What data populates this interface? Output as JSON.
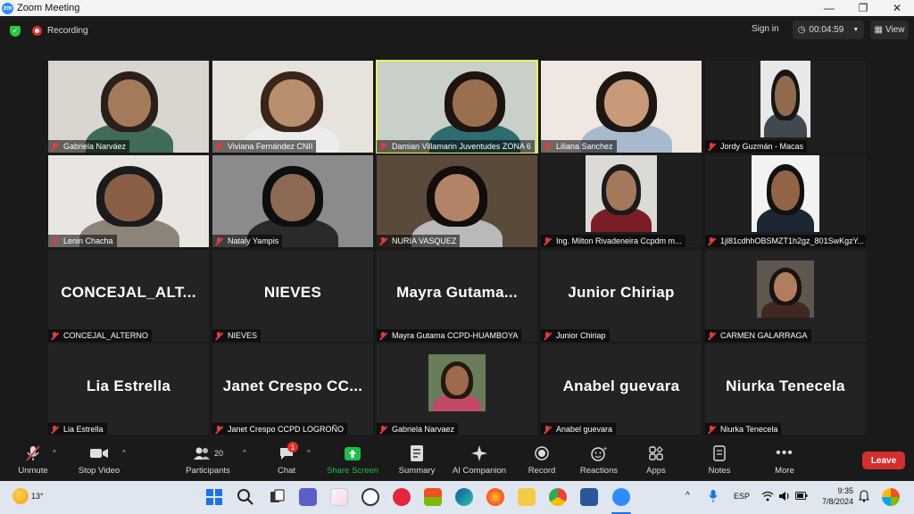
{
  "window": {
    "title": "Zoom Meeting",
    "app_badge": "zm"
  },
  "meeting_bar": {
    "recording_label": "Recording",
    "signin_label": "Sign in",
    "timer": "00:04:59",
    "view_label": "View"
  },
  "participants_tiles": [
    {
      "name": "Gabriela Narváez",
      "big": ""
    },
    {
      "name": "Viviana Fernández CNII",
      "big": ""
    },
    {
      "name": "Damian Villamarin Juventudes ZONA 6",
      "big": "",
      "active": true
    },
    {
      "name": "Liliana Sanchez",
      "big": ""
    },
    {
      "name": "Jordy Guzmán - Macas",
      "big": ""
    },
    {
      "name": "Lenin Chacha",
      "big": ""
    },
    {
      "name": "Nataly Yampis",
      "big": ""
    },
    {
      "name": "NURIA VASQUEZ",
      "big": ""
    },
    {
      "name": "Ing. Milton Rivadeneira Ccpdm m...",
      "big": ""
    },
    {
      "name": "1jl81cdhhOBSMZT1h2gz_801SwKgzY...",
      "big": ""
    },
    {
      "name": "CONCEJAL_ALTERNO",
      "big": "CONCEJAL_ALT..."
    },
    {
      "name": "NIEVES",
      "big": "NIEVES"
    },
    {
      "name": "Mayra Gutama CCPD-HUAMBOYA",
      "big": "Mayra Gutama..."
    },
    {
      "name": "Junior Chiriap",
      "big": "Junior Chiriap"
    },
    {
      "name": "CARMEN GALARRAGA",
      "big": ""
    },
    {
      "name": "Lia Estrella",
      "big": "Lia Estrella"
    },
    {
      "name": "Janet Crespo CCPD LOGROÑO",
      "big": "Janet Crespo CC..."
    },
    {
      "name": "Gabriela Narvaez",
      "big": ""
    },
    {
      "name": "Anabel guevara",
      "big": "Anabel guevara"
    },
    {
      "name": "Niurka Tenecela",
      "big": "Niurka Tenecela"
    }
  ],
  "toolbar": {
    "unmute": "Unmute",
    "stop_video": "Stop Video",
    "participants": "Participants",
    "participants_count": "20",
    "chat": "Chat",
    "chat_badge": "1",
    "share_screen": "Share Screen",
    "summary": "Summary",
    "ai_companion": "AI Companion",
    "record": "Record",
    "reactions": "Reactions",
    "apps": "Apps",
    "notes": "Notes",
    "more": "More",
    "leave": "Leave"
  },
  "taskbar": {
    "weather": "13°",
    "language": "ESP",
    "time": "9:35",
    "date": "7/8/2024"
  },
  "colors": {
    "share_green": "#1fbf4a",
    "leave_red": "#d32f2f",
    "active_border": "#e8ef5f",
    "muted_red": "#e03c3c"
  }
}
